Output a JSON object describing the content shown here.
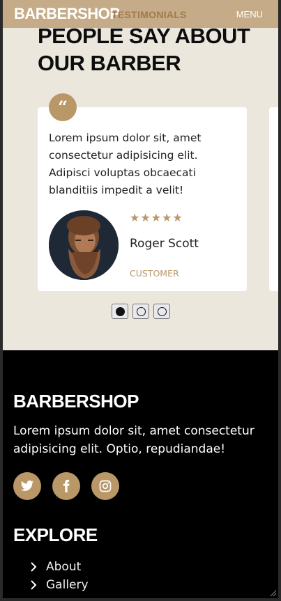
{
  "header": {
    "logo": "BARBERSHOP",
    "menu_label": "MENU"
  },
  "testimonials": {
    "eyebrow": "TESTIMONIALS",
    "title": "PEOPLE SAY ABOUT OUR BARBER",
    "quote_icon": "quote-icon",
    "card": {
      "text": "Lorem ipsum dolor sit, amet consectetur adipisicing elit. Adipisci voluptas obcaecati blanditiis impedit a velit!",
      "rating": 5,
      "name": "Roger Scott",
      "role": "CUSTOMER"
    },
    "pagination": {
      "count": 3,
      "active": 0
    }
  },
  "footer": {
    "logo": "BARBERSHOP",
    "text": "Lorem ipsum dolor sit, amet consectetur adipisicing elit. Optio, repudiandae!",
    "socials": [
      "twitter-icon",
      "facebook-icon",
      "instagram-icon"
    ],
    "explore_title": "EXPLORE",
    "links": [
      "About",
      "Gallery"
    ]
  },
  "colors": {
    "accent": "#b99767",
    "section_bg": "#ebe7dc",
    "footer_bg": "#000000"
  }
}
